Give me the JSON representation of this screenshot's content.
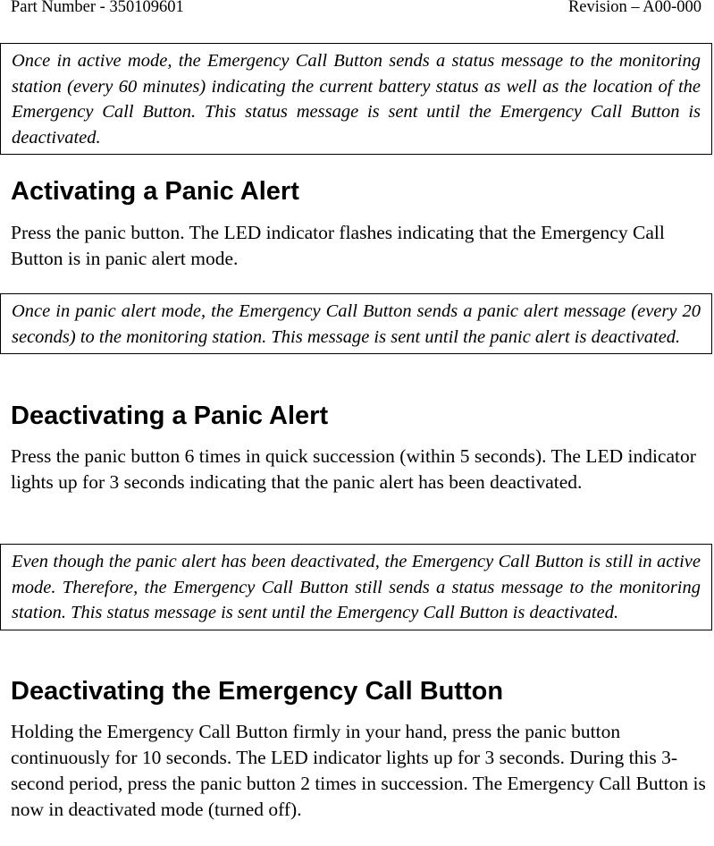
{
  "header": {
    "part_number": "Part Number - 350109601",
    "revision": "Revision – A00-000"
  },
  "note_active": "Once in active mode, the Emergency Call Button sends a status message to the monitoring station (every 60 minutes) indicating the current battery status as well as the location of the Emergency Call Button. This status message is sent until the Emergency Call Button is deactivated.",
  "sections": [
    {
      "heading": "Activating a Panic Alert",
      "body": "Press the panic button. The LED indicator flashes indicating that the Emergency Call Button is in panic alert mode.",
      "note": "Once in panic alert mode, the Emergency Call Button sends a panic alert message (every 20 seconds) to the monitoring station. This message is sent until the panic alert is deactivated."
    },
    {
      "heading": "Deactivating a Panic Alert",
      "body": "Press the panic button 6 times in quick succession (within 5 seconds). The LED indicator lights up for 3 seconds indicating that the panic alert has been deactivated.",
      "note": "Even though the panic alert has been deactivated, the Emergency Call Button is still in active mode. Therefore, the Emergency Call Button still sends a status message to the monitoring station. This status message is sent until the Emergency Call Button is deactivated."
    },
    {
      "heading": "Deactivating the Emergency Call Button",
      "body": "Holding the Emergency Call Button firmly in your hand, press the panic button continuously for 10 seconds. The LED indicator lights up for 3 seconds. During this 3-second period, press the panic button 2 times in succession. The Emergency Call Button is now in deactivated mode (turned off)."
    }
  ]
}
